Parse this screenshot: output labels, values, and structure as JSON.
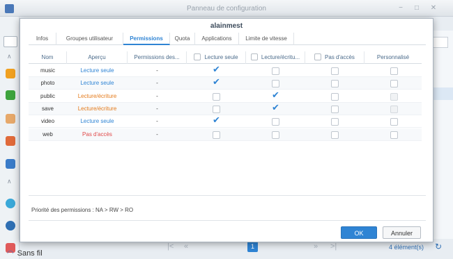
{
  "window": {
    "title": "Panneau de configuration"
  },
  "sidebar": {
    "wifi_label": "Sans fil"
  },
  "dialog": {
    "title": "alainmest",
    "tabs": [
      "Infos",
      "Groupes utilisateur",
      "Permissions",
      "Quota",
      "Applications",
      "Limite de vitesse"
    ],
    "active_tab": "Permissions",
    "columns": [
      "Nom",
      "Aperçu",
      "Permissions des...",
      "Lecture seule",
      "Lecture/écritu...",
      "Pas d'accès",
      "Personnalisé"
    ],
    "rows": [
      {
        "name": "music",
        "preview": "Lecture seule",
        "level": "ro",
        "perm": "-",
        "ro": true,
        "rw": false,
        "na": false,
        "custom": false
      },
      {
        "name": "photo",
        "preview": "Lecture seule",
        "level": "ro",
        "perm": "-",
        "ro": true,
        "rw": false,
        "na": false,
        "custom": false
      },
      {
        "name": "public",
        "preview": "Lecture/écriture",
        "level": "rw",
        "perm": "-",
        "ro": false,
        "rw": true,
        "na": false,
        "custom": false
      },
      {
        "name": "save",
        "preview": "Lecture/écriture",
        "level": "rw",
        "perm": "-",
        "ro": false,
        "rw": true,
        "na": false,
        "custom": false
      },
      {
        "name": "video",
        "preview": "Lecture seule",
        "level": "ro",
        "perm": "-",
        "ro": true,
        "rw": false,
        "na": false,
        "custom": false
      },
      {
        "name": "web",
        "preview": "Pas d'accès",
        "level": "na",
        "perm": "-",
        "ro": false,
        "rw": false,
        "na": false,
        "custom": false
      }
    ],
    "priority_text": "Priorité des permissions : NA > RW > RO",
    "ok_label": "OK",
    "cancel_label": "Annuler"
  },
  "pager": {
    "current_page": "1",
    "count_text": "4 élément(s)"
  },
  "colors": {
    "accent": "#2f84d4",
    "read_only": "#2f84d4",
    "read_write": "#e47a1a",
    "no_access": "#e04848"
  }
}
